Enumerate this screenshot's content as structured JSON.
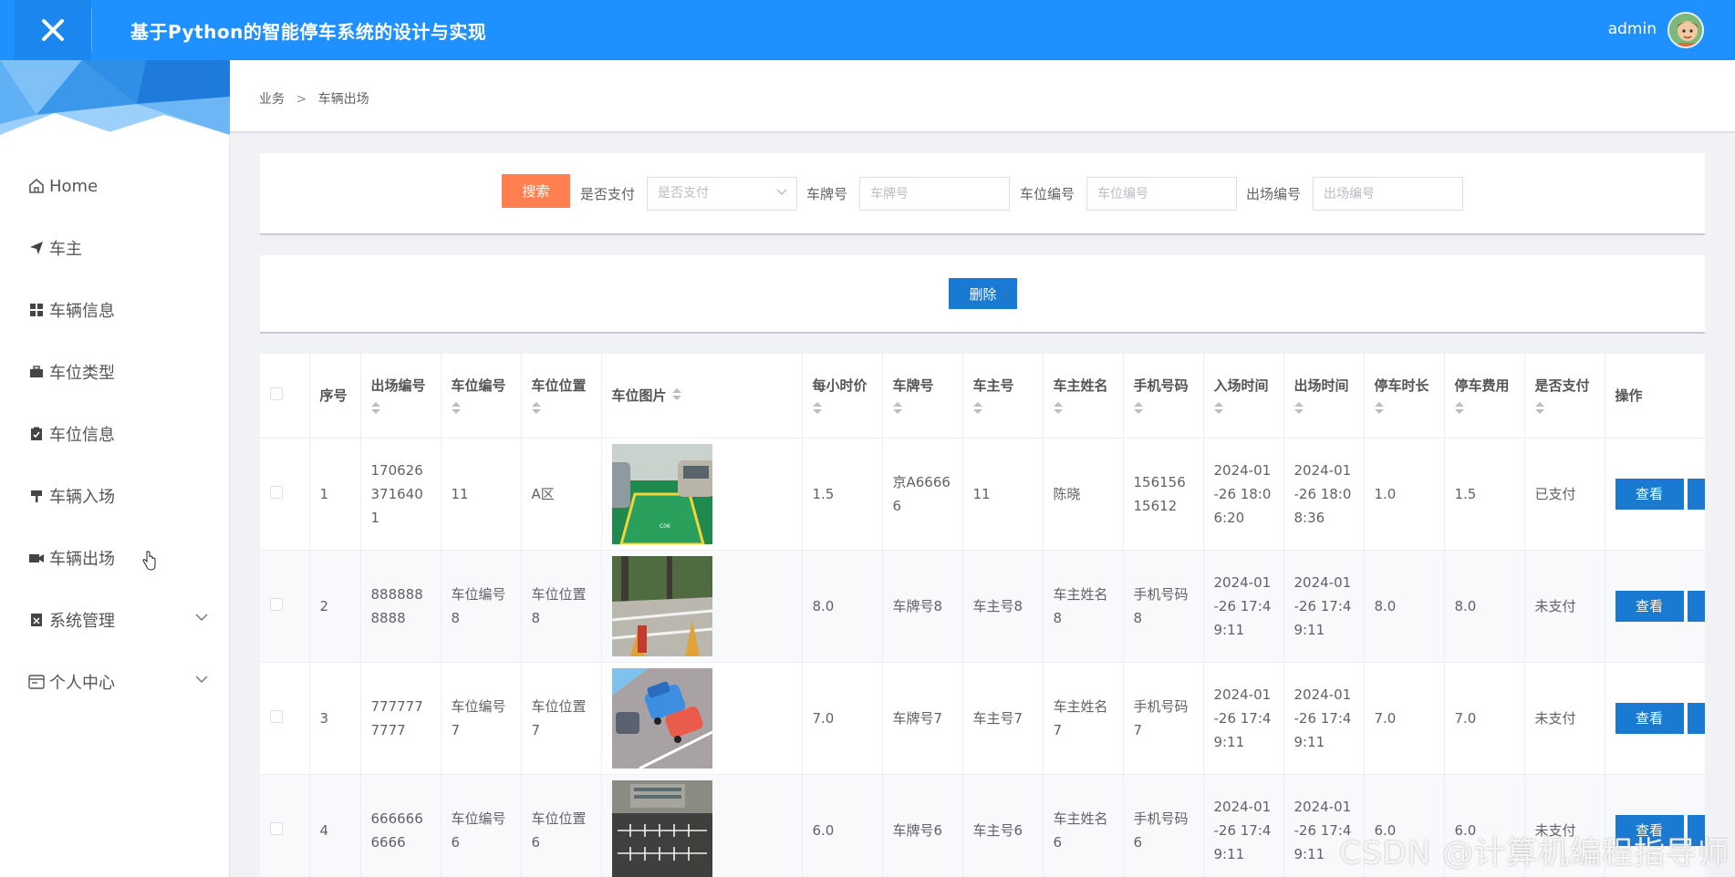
{
  "app": {
    "title": "基于Python的智能停车系统的设计与实现"
  },
  "user": {
    "name": "admin"
  },
  "sidebar": {
    "items": [
      {
        "label": "Home",
        "icon": "home-icon"
      },
      {
        "label": "车主",
        "icon": "paper-plane-icon"
      },
      {
        "label": "车辆信息",
        "icon": "grid-icon"
      },
      {
        "label": "车位类型",
        "icon": "suitcase-icon"
      },
      {
        "label": "车位信息",
        "icon": "clipboard-check-icon"
      },
      {
        "label": "车辆入场",
        "icon": "signpost-icon"
      },
      {
        "label": "车辆出场",
        "icon": "camera-icon"
      },
      {
        "label": "系统管理",
        "icon": "document-x-icon"
      },
      {
        "label": "个人中心",
        "icon": "browser-window-icon"
      }
    ]
  },
  "breadcrumb": {
    "parent": "业务",
    "separator": ">",
    "current": "车辆出场"
  },
  "search": {
    "button_label": "搜索",
    "fields": [
      {
        "label": "是否支付",
        "placeholder": "是否支付",
        "type": "select"
      },
      {
        "label": "车牌号",
        "placeholder": "车牌号",
        "type": "input"
      },
      {
        "label": "车位编号",
        "placeholder": "车位编号",
        "type": "input"
      },
      {
        "label": "出场编号",
        "placeholder": "出场编号",
        "type": "input"
      }
    ]
  },
  "actions": {
    "delete_label": "删除"
  },
  "table": {
    "headers": {
      "index": "序号",
      "exit_no": "出场编号",
      "space_no": "车位编号",
      "space_location": "车位位置",
      "space_image": "车位图片",
      "hourly_price": "每小时价",
      "plate": "车牌号",
      "owner_no": "车主号",
      "owner_name": "车主姓名",
      "phone": "手机号码",
      "entry_time": "入场时间",
      "exit_time": "出场时间",
      "duration": "停车时长",
      "fee": "停车费用",
      "paid": "是否支付",
      "ops": "操作"
    },
    "view_label": "查看",
    "rows": [
      {
        "index": "1",
        "exit_no": "1706263716401",
        "space_no": "11",
        "space_location": "A区",
        "image": "parking-garage-photo",
        "hourly_price": "1.5",
        "plate": "京A66666",
        "owner_no": "11",
        "owner_name": "陈晓",
        "phone": "15615615612",
        "entry_time": "2024-01-26 18:06:20",
        "exit_time": "2024-01-26 18:08:36",
        "duration": "1.0",
        "fee": "1.5",
        "paid": "已支付"
      },
      {
        "index": "2",
        "exit_no": "8888888888",
        "space_no": "车位编号8",
        "space_location": "车位位置8",
        "image": "outdoor-lot-photo",
        "hourly_price": "8.0",
        "plate": "车牌号8",
        "owner_no": "车主号8",
        "owner_name": "车主姓名8",
        "phone": "手机号码8",
        "entry_time": "2024-01-26 17:49:11",
        "exit_time": "2024-01-26 17:49:11",
        "duration": "8.0",
        "fee": "8.0",
        "paid": "未支付"
      },
      {
        "index": "3",
        "exit_no": "7777777777",
        "space_no": "车位编号7",
        "space_location": "车位位置7",
        "image": "cartoon-cars-illustration",
        "hourly_price": "7.0",
        "plate": "车牌号7",
        "owner_no": "车主号7",
        "owner_name": "车主姓名7",
        "phone": "手机号码7",
        "entry_time": "2024-01-26 17:49:11",
        "exit_time": "2024-01-26 17:49:11",
        "duration": "7.0",
        "fee": "7.0",
        "paid": "未支付"
      },
      {
        "index": "4",
        "exit_no": "6666666666",
        "space_no": "车位编号6",
        "space_location": "车位位置6",
        "image": "aerial-lot-photo",
        "hourly_price": "6.0",
        "plate": "车牌号6",
        "owner_no": "车主号6",
        "owner_name": "车主姓名6",
        "phone": "手机号码6",
        "entry_time": "2024-01-26 17:49:11",
        "exit_time": "2024-01-26 17:49:11",
        "duration": "6.0",
        "fee": "6.0",
        "paid": "未支付"
      }
    ]
  },
  "watermark": "CSDN @计算机编程指导师",
  "colors": {
    "header": "#1e90ff",
    "search_button": "#ff7f50",
    "primary_button": "#1a79d1"
  }
}
